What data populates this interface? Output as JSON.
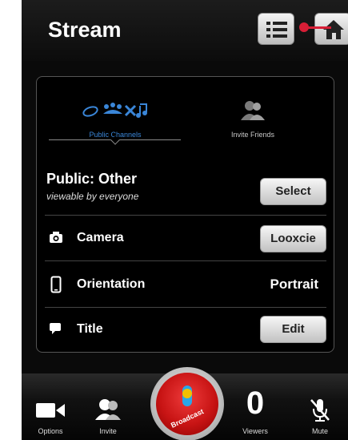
{
  "header": {
    "title": "Stream",
    "list_icon": "list-icon",
    "home_icon": "home-icon"
  },
  "tabs": [
    {
      "label": "Public Channels",
      "icon": "public-channels-icon",
      "selected": true
    },
    {
      "label": "Invite Friends",
      "icon": "people-icon",
      "selected": false
    }
  ],
  "rows": {
    "public": {
      "title": "Public: Other",
      "subtitle": "viewable by everyone",
      "button": "Select"
    },
    "camera": {
      "label": "Camera",
      "icon": "camera-icon",
      "button": "Looxcie"
    },
    "orientation": {
      "label": "Orientation",
      "icon": "phone-icon",
      "value": "Portrait"
    },
    "title": {
      "label": "Title",
      "icon": "speech-bubble-icon",
      "button": "Edit"
    }
  },
  "bottombar": {
    "options": "Options",
    "invite": "Invite",
    "broadcast": "Broadcast",
    "viewers_count": "0",
    "viewers": "Viewers",
    "mute": "Mute"
  },
  "colors": {
    "accent_blue": "#3a86d8",
    "broadcast_red": "#c81414",
    "pointer_red": "#d81e36"
  }
}
